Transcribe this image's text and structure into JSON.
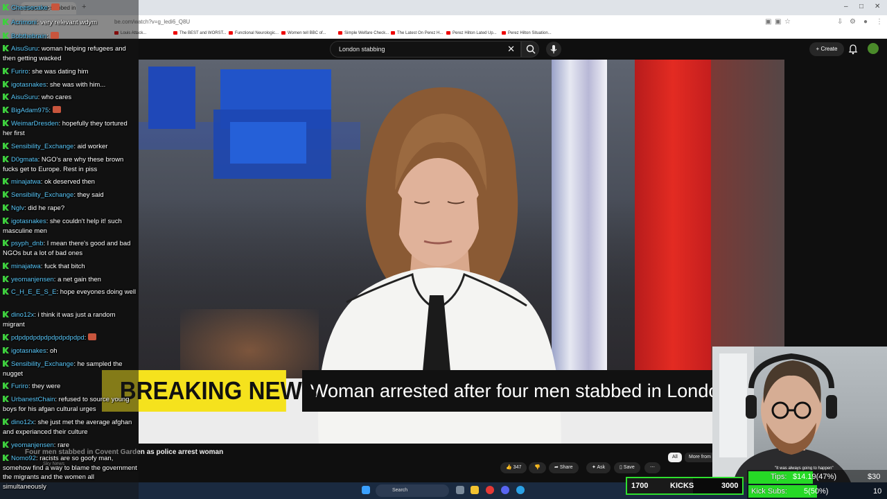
{
  "browser": {
    "tab_title": "Four men stabbed in Covent",
    "new_tab": "+",
    "url": "be.com/watch?v=g_ledi6_Q8U",
    "bookmarks": [
      "Louis Attack...",
      "The BEST and WORST...",
      "Functional Neurologic...",
      "Women tell BBC of...",
      "Simple Welfare Check...",
      "The Latest On Perez H...",
      "Perez Hilton Lated Up...",
      "Perez Hilton Situation..."
    ],
    "window_controls": [
      "–",
      "□",
      "✕"
    ]
  },
  "youtube": {
    "search_query": "London stabbing",
    "create_label": "Create",
    "video_title": "Four men stabbed in Covent Garden as police arrest woman",
    "channel_name": "Sky News",
    "like_count": "347",
    "share_label": "Share",
    "ask_label": "Ask",
    "save_label": "Save",
    "chip_all": "All",
    "chip_more": "More from"
  },
  "video": {
    "breaking_label": "BREAKING NEWS",
    "headline": "Woman arrested after four men stabbed in London"
  },
  "chat": {
    "messages": [
      {
        "user": "Cheesecake",
        "text": ""
      },
      {
        "user": "Acrimoni",
        "text": "very relevant wdym"
      },
      {
        "user": "Bobthebrain",
        "text": ""
      },
      {
        "user": "AisuSuru",
        "text": "woman helping refugees and then getting wacked"
      },
      {
        "user": "Furiro",
        "text": "she was dating him"
      },
      {
        "user": "igotasnakes",
        "text": "she was with him..."
      },
      {
        "user": "AisuSuru",
        "text": "who cares"
      },
      {
        "user": "BigAdam975",
        "text": ""
      },
      {
        "user": "WeimarDresden",
        "text": "hopefully they tortured her first"
      },
      {
        "user": "Sensibility_Exchange",
        "text": "aid worker"
      },
      {
        "user": "D0gmata",
        "text": "NGO's are why these brown fucks get to Europe. Rest in piss"
      },
      {
        "user": "minajatwa",
        "text": "ok deserved then"
      },
      {
        "user": "Sensibility_Exchange",
        "text": "they said"
      },
      {
        "user": "Nglv",
        "text": "did he rape?"
      },
      {
        "user": "igotasnakes",
        "text": "she couldn't help it! such masculine men"
      },
      {
        "user": "psyph_dnb",
        "text": "I mean there's good and bad NGOs but a lot of bad ones"
      },
      {
        "user": "minajatwa",
        "text": "fuck that bitch"
      },
      {
        "user": "yeomanjensen",
        "text": "a net gain then"
      },
      {
        "user": "C_H_E_E_S_E",
        "text": "hope eveyones doing well"
      },
      {
        "user": "dino12x",
        "text": "i think it was just a random migrant"
      },
      {
        "user": "pdpdpdpdpdpdpdpdpdpd",
        "text": ""
      },
      {
        "user": "igotasnakes",
        "text": "oh"
      },
      {
        "user": "Sensibility_Exchange",
        "text": "he sampled the nugget"
      },
      {
        "user": "Furiro",
        "text": "they were"
      },
      {
        "user": "UrbanestChain",
        "text": "refused to source young boys for his afgan cultural urges"
      },
      {
        "user": "dino12x",
        "text": "she just met the average afghan and experianced their culture"
      },
      {
        "user": "yeomanjensen",
        "text": "rare"
      },
      {
        "user": "Nomo92",
        "text": "racists are so goofy man, somehow find a way to blame the government the migrants and the women all simultaneously"
      }
    ]
  },
  "stream": {
    "kicks_current": "1700",
    "kicks_label": "KICKS",
    "kicks_goal": "3000",
    "kicks_progress": 0.57,
    "tips_label": "Tips:",
    "tips_value": "$14.19(47%)",
    "tips_goal": "$30",
    "tips_progress": 0.47,
    "subs_label": "Kick Subs:",
    "subs_value": "5(50%)",
    "subs_goal": "10",
    "subs_progress": 0.5,
    "notice": "\"It was always going to happen\""
  },
  "taskbar": {
    "search_placeholder": "Search"
  },
  "colors": {
    "breaking_yellow": "#f5e21d",
    "kick_green": "#3ecf3e",
    "sky_red": "#e32b22"
  }
}
